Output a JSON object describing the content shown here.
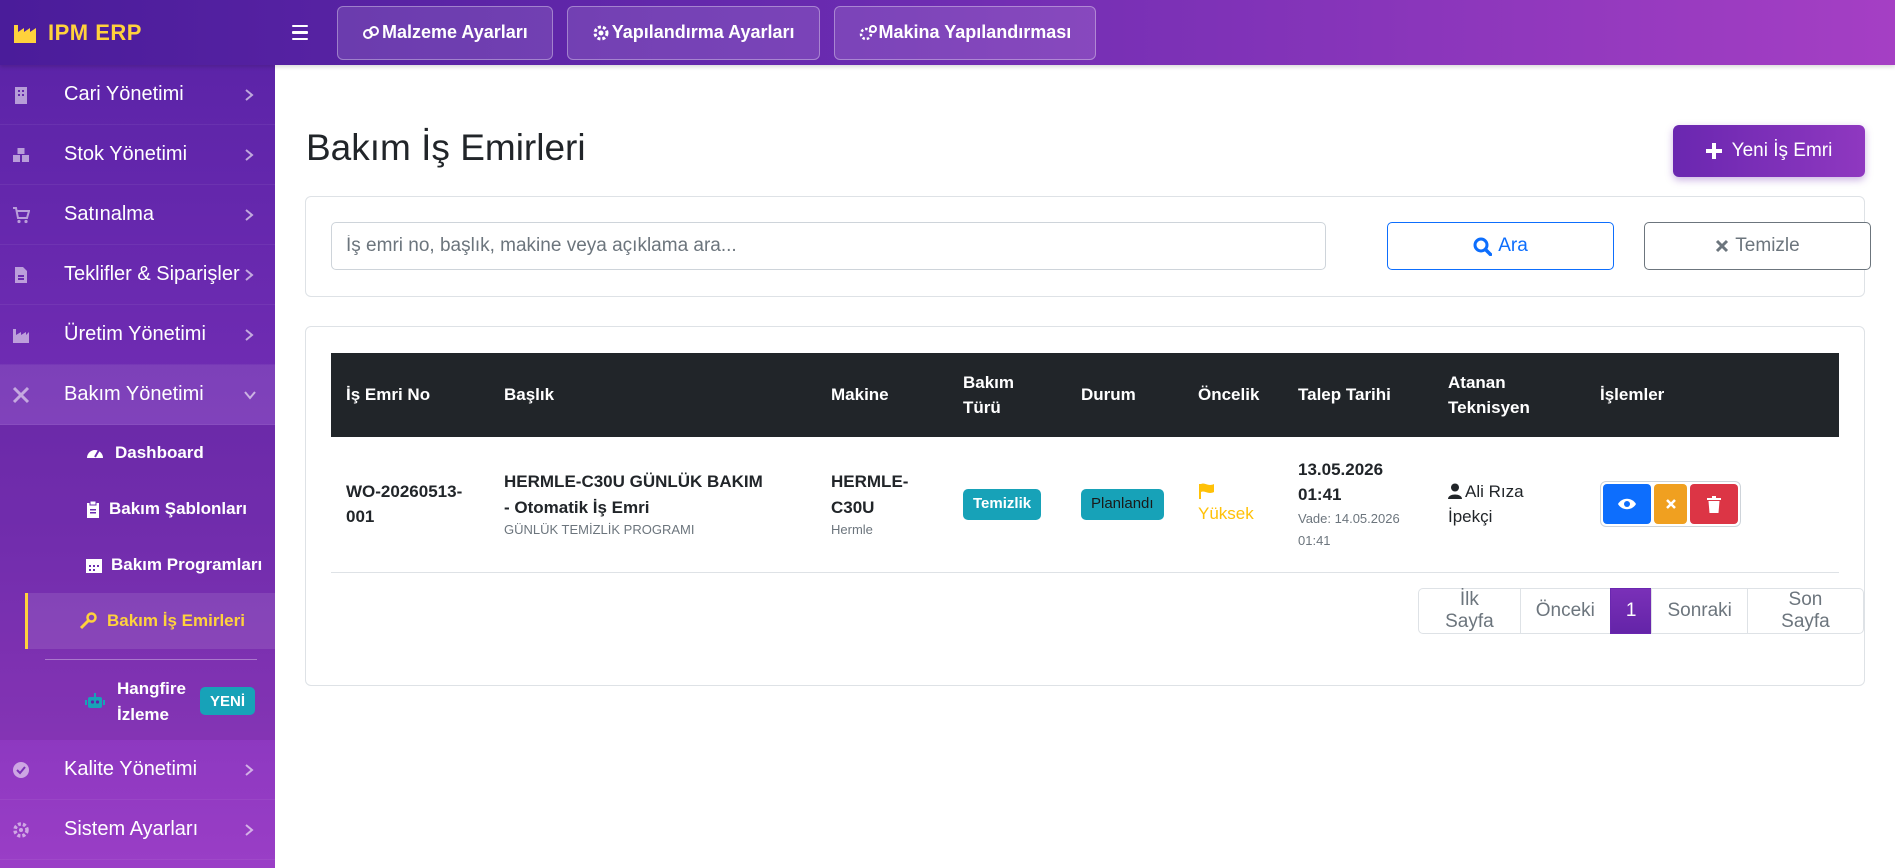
{
  "brand": {
    "title": "IPM ERP"
  },
  "topbar": {
    "buttons": [
      "Malzeme Ayarları",
      "Yapılandırma Ayarları",
      "Makina Yapılandırması"
    ]
  },
  "sidebar": {
    "items": [
      {
        "label": "Cari Yönetimi",
        "icon": "building-icon"
      },
      {
        "label": "Stok Yönetimi",
        "icon": "boxes-icon"
      },
      {
        "label": "Satınalma",
        "icon": "cart-icon"
      },
      {
        "label": "Teklifler & Siparişler",
        "icon": "file-invoice-icon"
      },
      {
        "label": "Üretim Yönetimi",
        "icon": "industry-icon"
      },
      {
        "label": "Bakım Yönetimi",
        "icon": "tools-icon"
      },
      {
        "label": "Kalite Yönetimi",
        "icon": "check-circle-icon"
      },
      {
        "label": "Sistem Ayarları",
        "icon": "cog-icon"
      }
    ],
    "submenu": [
      {
        "label": "Dashboard",
        "icon": "tachometer-icon"
      },
      {
        "label": "Bakım Şablonları",
        "icon": "clipboard-icon"
      },
      {
        "label": "Bakım Programları",
        "icon": "calendar-icon"
      },
      {
        "label": "Bakım İş Emirleri",
        "icon": "wrench-icon"
      },
      {
        "label": "Hangfire İzleme",
        "icon": "robot-icon",
        "badge": "YENİ"
      }
    ]
  },
  "page": {
    "title": "Bakım İş Emirleri",
    "new_button": "Yeni İş Emri"
  },
  "search": {
    "placeholder": "İş emri no, başlık, makine veya açıklama ara...",
    "search_label": "Ara",
    "clear_label": "Temizle"
  },
  "table": {
    "headers": {
      "no": "İş Emri No",
      "title": "Başlık",
      "machine": "Makine",
      "type": "Bakım Türü",
      "status": "Durum",
      "priority": "Öncelik",
      "date": "Talep Tarihi",
      "tech": "Atanan Teknisyen",
      "actions": "İşlemler"
    },
    "rows": [
      {
        "no": "WO-20260513-001",
        "title": "HERMLE-C30U GÜNLÜK BAKIM - Otomatik İş Emri",
        "program": "GÜNLÜK TEMİZLİK PROGRAMI",
        "machine": "HERMLE-C30U",
        "brand": "Hermle",
        "type": "Temizlik",
        "status": "Planlandı",
        "priority": "Yüksek",
        "date": "13.05.2026 01:41",
        "due": "Vade: 14.05.2026 01:41",
        "tech": "Ali Rıza İpekçi"
      }
    ]
  },
  "pagination": {
    "first": "İlk Sayfa",
    "prev": "Önceki",
    "current": "1",
    "next": "Sonraki",
    "last": "Son Sayfa"
  },
  "colors": {
    "accent": "#6a27b0",
    "brand_yellow": "#ffd23c",
    "info": "#17a2b8",
    "primary": "#0d6efd",
    "danger": "#dc3545",
    "warning": "#ffc107"
  }
}
